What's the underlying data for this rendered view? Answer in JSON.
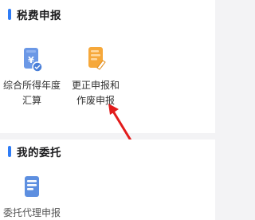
{
  "colors": {
    "accent": "#2f7cf6",
    "icon_blue": "#5d8fe0",
    "icon_orange": "#f5a431",
    "arrow_red": "#e21b1b"
  },
  "sections": [
    {
      "title": "税费申报",
      "items": [
        {
          "label": "综合所得年度\n汇算",
          "icon": "tax-document-icon"
        },
        {
          "label": "更正申报和\n作废申报",
          "icon": "correction-document-icon"
        }
      ]
    },
    {
      "title": "我的委托",
      "items": [
        {
          "label": "委托代理申报",
          "icon": "delegation-document-icon"
        }
      ]
    }
  ]
}
